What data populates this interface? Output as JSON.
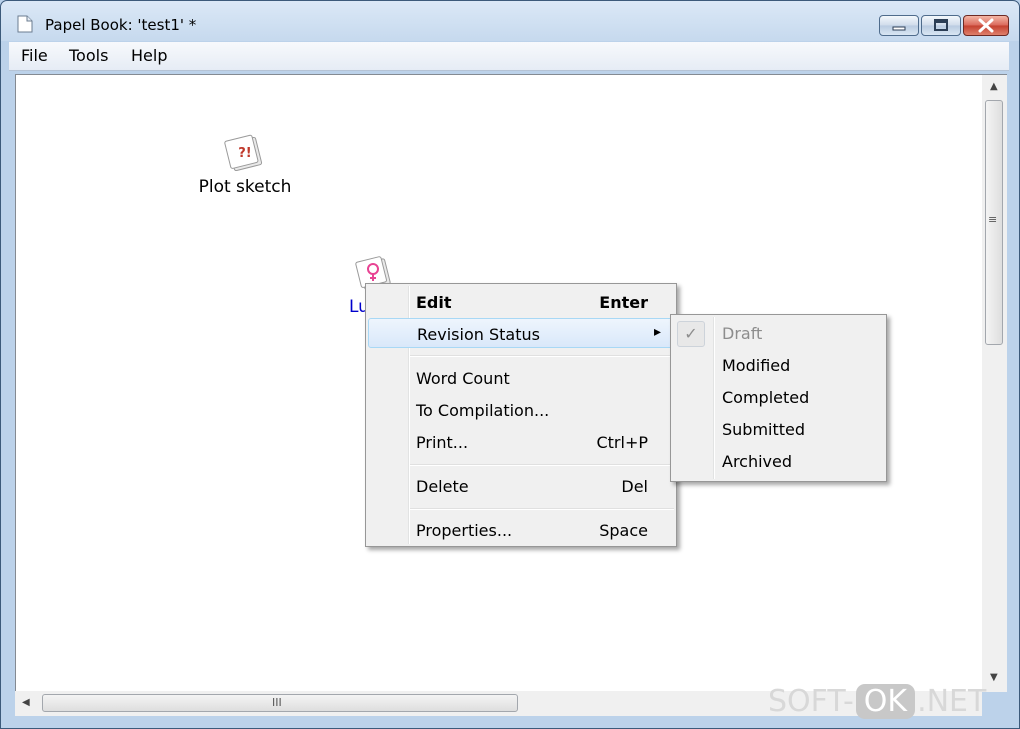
{
  "window": {
    "title": "Papel Book: 'test1' *"
  },
  "menubar": {
    "items": [
      "File",
      "Tools",
      "Help"
    ]
  },
  "canvas": {
    "nodes": [
      {
        "label": "Plot sketch",
        "icon": "question-exclaim-note-icon"
      },
      {
        "label": "Lu",
        "icon": "female-character-note-icon"
      }
    ]
  },
  "context_menu": {
    "items": [
      {
        "label": "Edit",
        "shortcut": "Enter"
      },
      {
        "label": "Revision Status",
        "shortcut": ""
      },
      {
        "label": "Word Count",
        "shortcut": ""
      },
      {
        "label": "To Compilation...",
        "shortcut": ""
      },
      {
        "label": "Print...",
        "shortcut": "Ctrl+P"
      },
      {
        "label": "Delete",
        "shortcut": "Del"
      },
      {
        "label": "Properties...",
        "shortcut": "Space"
      }
    ],
    "submenu_arrow": "▸"
  },
  "revision_submenu": {
    "check_glyph": "✓",
    "items": [
      {
        "label": "Draft",
        "checked": true,
        "enabled": false
      },
      {
        "label": "Modified",
        "checked": false,
        "enabled": true
      },
      {
        "label": "Completed",
        "checked": false,
        "enabled": true
      },
      {
        "label": "Submitted",
        "checked": false,
        "enabled": true
      },
      {
        "label": "Archived",
        "checked": false,
        "enabled": true
      }
    ]
  },
  "scrollbars": {
    "up_arrow": "▲",
    "down_arrow": "▼",
    "left_arrow": "◀",
    "grip_v": "≡",
    "grip_h": "III"
  },
  "watermark": {
    "left": "SOFT-",
    "middle": "OK",
    "right": ".NET"
  },
  "colors": {
    "highlight_border": "#a8d8f5",
    "node_link_label": "#0000cc",
    "note_accent_red": "#c0392b",
    "note_accent_pink": "#e84393"
  }
}
